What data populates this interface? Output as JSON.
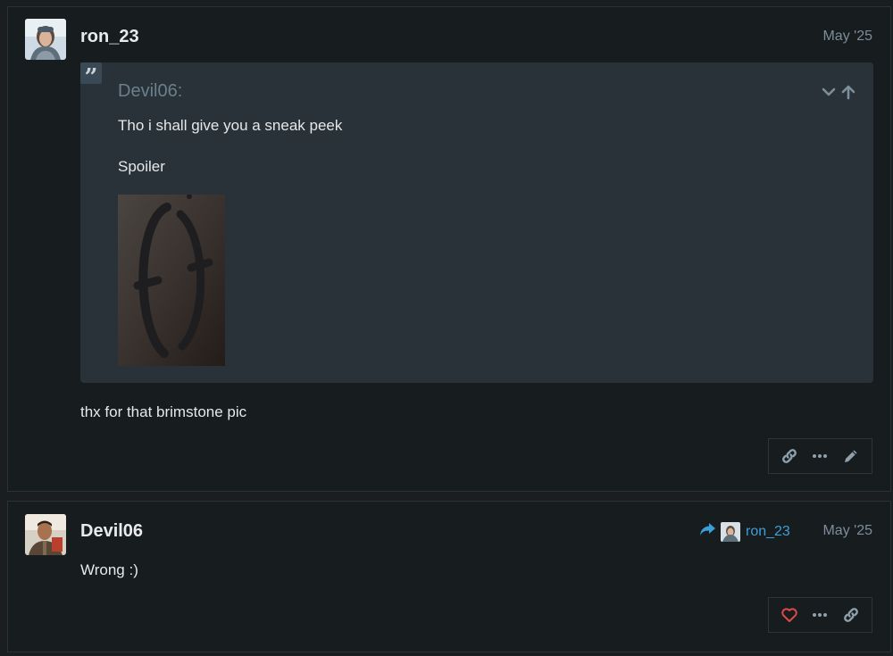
{
  "posts": [
    {
      "username": "ron_23",
      "date": "May '25",
      "quote": {
        "author": "Devil06:",
        "line1": "Tho i shall give you a sneak peek",
        "line2": "Spoiler"
      },
      "body": "thx for that brimstone pic",
      "actions": [
        "link-icon",
        "more-icon",
        "edit-icon"
      ]
    },
    {
      "username": "Devil06",
      "date": "May '25",
      "reply_to": "ron_23",
      "body": "Wrong :)",
      "actions": [
        "heart-icon",
        "more-icon",
        "link-icon"
      ]
    }
  ],
  "colors": {
    "accent": "#3aa0d8",
    "heart": "#e0484c",
    "icon": "#8fa1ad",
    "quote_bg": "#283238"
  }
}
